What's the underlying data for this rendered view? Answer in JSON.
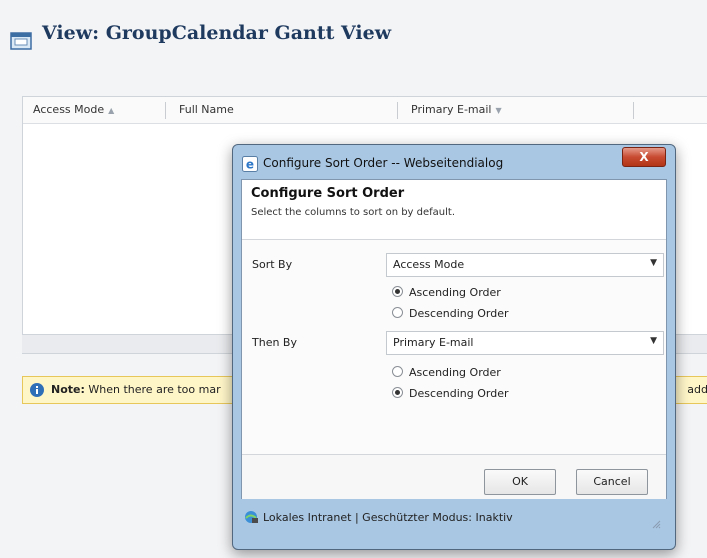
{
  "page": {
    "title": "View: GroupCalendar Gantt View"
  },
  "grid": {
    "columns": [
      {
        "label": "Access Mode",
        "sort": "ascending"
      },
      {
        "label": "Full Name",
        "sort": ""
      },
      {
        "label": "Primary E-mail",
        "sort": "descending"
      }
    ]
  },
  "note": {
    "bold": "Note:",
    "text": "When there are too mar",
    "tail": "add"
  },
  "dialog": {
    "window_title": "Configure Sort Order -- Webseitendialog",
    "close_label": "X",
    "heading": "Configure Sort Order",
    "subheading": "Select the columns to sort on by default.",
    "sort_by": {
      "label": "Sort By",
      "selected": "Access Mode",
      "ascending_label": "Ascending Order",
      "descending_label": "Descending Order",
      "order": "ascending"
    },
    "then_by": {
      "label": "Then By",
      "selected": "Primary E-mail",
      "ascending_label": "Ascending Order",
      "descending_label": "Descending Order",
      "order": "descending"
    },
    "ok_label": "OK",
    "cancel_label": "Cancel",
    "status_text": "Lokales Intranet | Geschützter Modus: Inaktiv"
  },
  "icons": {
    "view": "view-icon",
    "sort_asc": "▲",
    "sort_desc": "▼",
    "dropdown": "▼",
    "note": "info-icon",
    "browser": "ie-icon",
    "zone": "intranet-icon"
  },
  "colors": {
    "title": "#1f3a5f",
    "note_bg": "#fff6c8",
    "dialog_frame": "#a9c7e3",
    "close_button": "#c84b31"
  }
}
